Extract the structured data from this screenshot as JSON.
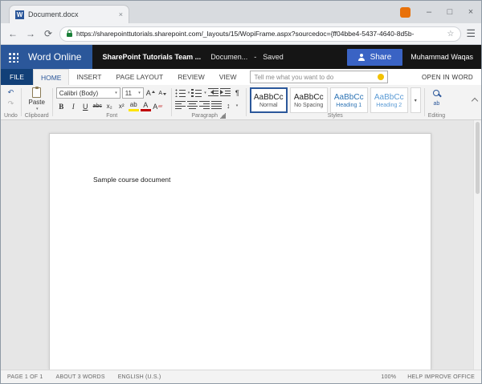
{
  "colors": {
    "accent_blue": "#2b579a",
    "file_tab_blue": "#124078",
    "share_blue": "#3a63c4",
    "heading_blue": "#2e74b5",
    "padlock_green": "#1a7f37",
    "bulb_yellow": "#f2c100"
  },
  "browser": {
    "tab_title": "Document.docx",
    "url": "https://sharepointtutorials.sharepoint.com/_layouts/15/WopiFrame.aspx?sourcedoc={ff04bbe4-5437-4640-8d5b-"
  },
  "suite_bar": {
    "app_name": "Word Online",
    "site_label": "SharePoint Tutorials Team ...",
    "doc_label": "Documen...",
    "separator": "-",
    "save_status": "Saved",
    "share_label": "Share",
    "user_name": "Muhammad Waqas"
  },
  "ribbon": {
    "tabs": [
      "FILE",
      "HOME",
      "INSERT",
      "PAGE LAYOUT",
      "REVIEW",
      "VIEW"
    ],
    "tell_me_placeholder": "Tell me what you want to do",
    "open_in_word_label": "OPEN IN WORD",
    "paste_label": "Paste",
    "font_name": "Calibri (Body)",
    "font_size": "11",
    "groups": {
      "undo": "Undo",
      "clipboard": "Clipboard",
      "font": "Font",
      "paragraph": "Paragraph",
      "styles": "Styles",
      "editing": "Editing"
    },
    "styles": [
      {
        "preview": "AaBbCc",
        "name": "Normal"
      },
      {
        "preview": "AaBbCc",
        "name": "No Spacing"
      },
      {
        "preview": "AaBbCc",
        "name": "Heading 1"
      },
      {
        "preview": "AaBbCc",
        "name": "Heading 2"
      }
    ]
  },
  "glyphs": {
    "word": "W",
    "close": "×",
    "minimize": "–",
    "maximize": "□",
    "back": "←",
    "forward": "→",
    "refresh": "⟳",
    "star": "☆",
    "menu": "☰",
    "undo": "↶",
    "redo": "↷",
    "bold": "B",
    "italic": "I",
    "underline": "U",
    "strikethrough": "abc",
    "subscript": "x₂",
    "superscript": "x²",
    "grow_font": "A",
    "shrink_font": "A",
    "highlight": "ab",
    "font_color": "A",
    "clear_format": "A",
    "pilcrow": "¶",
    "line_spacing": "↕",
    "replace": "ab",
    "dropdown": "▾"
  },
  "document": {
    "text": "Sample course document"
  },
  "status_bar": {
    "page": "PAGE 1 OF 1",
    "words": "ABOUT 3 WORDS",
    "language": "ENGLISH (U.S.)",
    "zoom": "100%",
    "help": "HELP IMPROVE OFFICE"
  }
}
